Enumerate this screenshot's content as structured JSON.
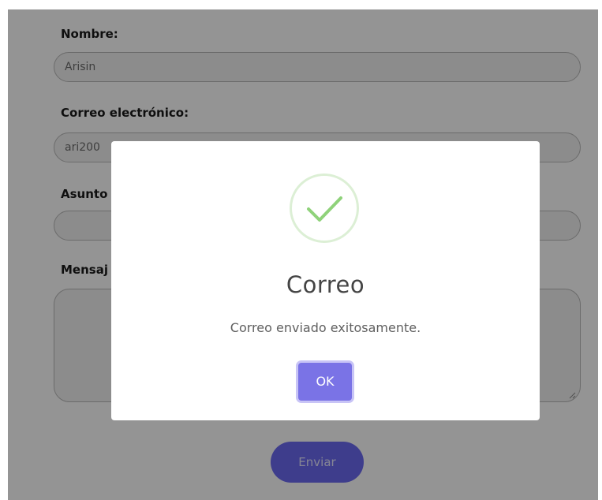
{
  "form": {
    "name_label": "Nombre:",
    "name_value": "Arisin",
    "email_label": "Correo electrónico:",
    "email_value": "ari200",
    "subject_label": "Asunto",
    "subject_value": "",
    "message_label": "Mensaj",
    "message_value": "",
    "send_button": "Enviar"
  },
  "dialog": {
    "icon": "check-icon",
    "title": "Correo",
    "message": "Correo enviado exitosamente.",
    "ok_button": "OK"
  },
  "colors": {
    "accent": "#7a73e6",
    "send_button": "#6c6af2",
    "success": "#8fd27a",
    "overlay": "rgba(0,0,0,0.42)"
  }
}
